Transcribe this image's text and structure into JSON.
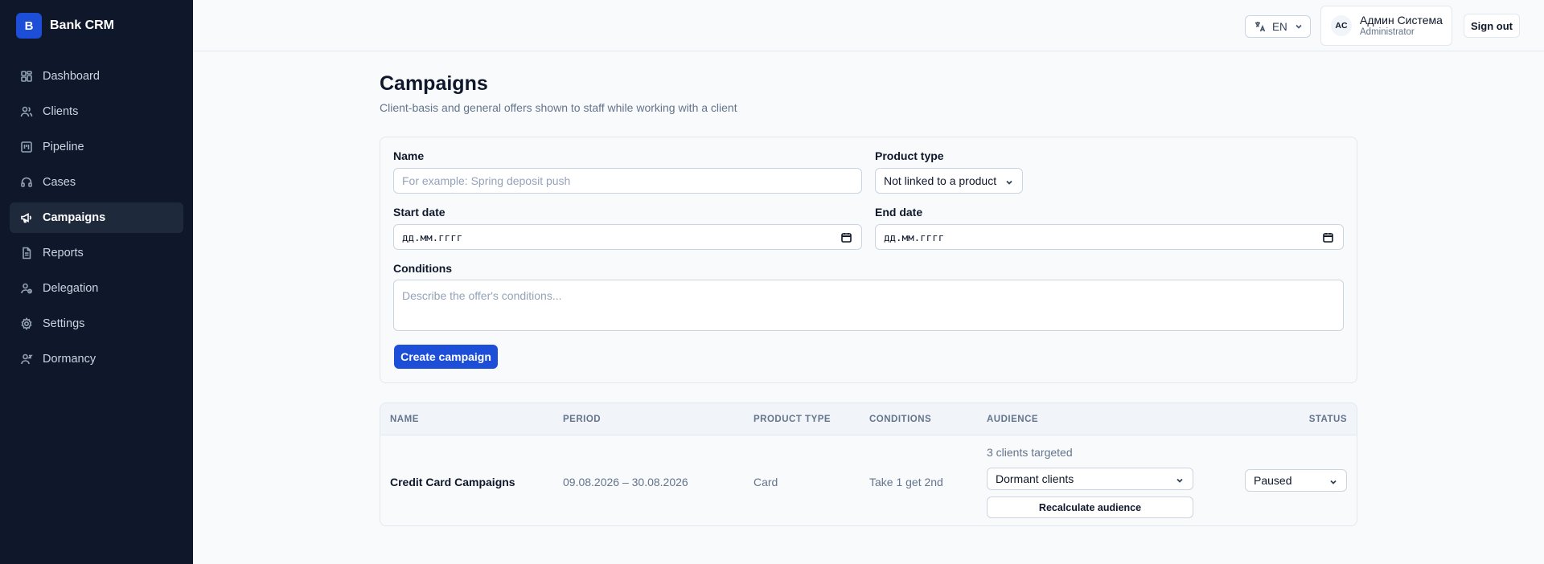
{
  "brand": {
    "logo_letter": "B",
    "name": "Bank CRM",
    "accent": "#1d4ed8"
  },
  "sidebar": {
    "items": [
      {
        "label": "Dashboard",
        "icon": "dashboard-icon"
      },
      {
        "label": "Clients",
        "icon": "users-icon"
      },
      {
        "label": "Pipeline",
        "icon": "pipeline-icon"
      },
      {
        "label": "Cases",
        "icon": "headset-icon"
      },
      {
        "label": "Campaigns",
        "icon": "megaphone-icon",
        "active": true
      },
      {
        "label": "Reports",
        "icon": "report-icon"
      },
      {
        "label": "Delegation",
        "icon": "delegation-icon"
      },
      {
        "label": "Settings",
        "icon": "gear-icon"
      },
      {
        "label": "Dormancy",
        "icon": "dormancy-icon"
      }
    ]
  },
  "header": {
    "language": "EN",
    "user": {
      "initials": "AC",
      "name": "Админ Система",
      "role": "Administrator"
    },
    "signout_label": "Sign out"
  },
  "page": {
    "title": "Campaigns",
    "subtitle": "Client-basis and general offers shown to staff while working with a client"
  },
  "form": {
    "name_label": "Name",
    "name_placeholder": "For example: Spring deposit push",
    "product_type_label": "Product type",
    "product_type_value": "Not linked to a product",
    "start_date_label": "Start date",
    "start_date_value": "дд.мм.гггг",
    "end_date_label": "End date",
    "end_date_value": "дд.мм.гггг",
    "conditions_label": "Conditions",
    "conditions_placeholder": "Describe the offer's conditions...",
    "submit_label": "Create campaign"
  },
  "table": {
    "columns": [
      "NAME",
      "PERIOD",
      "PRODUCT TYPE",
      "CONDITIONS",
      "AUDIENCE",
      "STATUS"
    ],
    "rows": [
      {
        "name": "Credit Card Campaigns",
        "period": "09.08.2026 – 30.08.2026",
        "product_type": "Card",
        "conditions": "Take 1 get 2nd",
        "audience_count": "3 clients targeted",
        "audience_segment": "Dormant clients",
        "recalculate_label": "Recalculate audience",
        "status": "Paused"
      }
    ]
  }
}
